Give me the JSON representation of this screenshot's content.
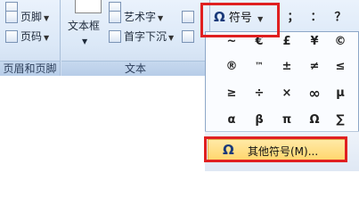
{
  "ribbon": {
    "left_items": [
      {
        "label": "页脚",
        "icon": "footer-icon"
      },
      {
        "label": "页码",
        "icon": "page-number-icon"
      }
    ],
    "text_box_label": "文本框",
    "mid_items": [
      {
        "label": "艺术字",
        "icon": "wordart-icon"
      },
      {
        "label": "首字下沉",
        "icon": "drop-cap-icon"
      }
    ],
    "group_labels": {
      "header_footer": "页眉和页脚",
      "text": "文本"
    },
    "top_symbols": [
      "；",
      "：",
      "？"
    ]
  },
  "symbol_button": {
    "icon_glyph": "Ω",
    "label": "符号"
  },
  "symbol_grid": [
    [
      "~",
      "€",
      "£",
      "¥",
      "©"
    ],
    [
      "®",
      "™",
      "±",
      "≠",
      "≤"
    ],
    [
      "≥",
      "÷",
      "×",
      "∞",
      "μ"
    ],
    [
      "α",
      "β",
      "π",
      "Ω",
      "∑"
    ]
  ],
  "more_symbols": {
    "icon_glyph": "Ω",
    "label": "其他符号(M)..."
  },
  "colors": {
    "highlight": "#e02020",
    "hover": "#ffd76e"
  }
}
